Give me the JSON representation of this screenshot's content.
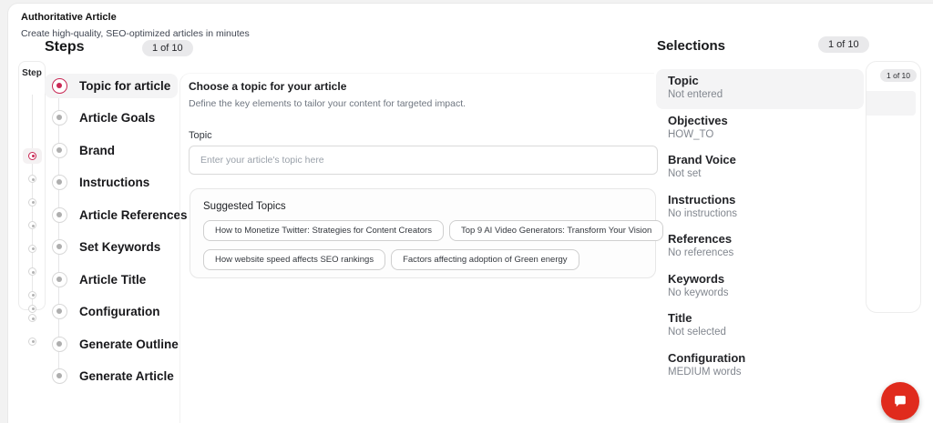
{
  "header": {
    "app_title": "Authoritative Article",
    "app_subtitle": "Create high-quality, SEO-optimized articles in minutes"
  },
  "steps": {
    "title": "Steps",
    "badge": "1 of 10",
    "mini_label": "Step",
    "items": [
      {
        "label": "Topic for article"
      },
      {
        "label": "Article Goals"
      },
      {
        "label": "Brand"
      },
      {
        "label": "Instructions"
      },
      {
        "label": "Article References"
      },
      {
        "label": "Set Keywords"
      },
      {
        "label": "Article Title"
      },
      {
        "label": "Configuration"
      },
      {
        "label": "Generate Outline"
      },
      {
        "label": "Generate Article"
      }
    ],
    "active_index": 0
  },
  "main": {
    "heading": "Choose a topic for your article",
    "description": "Define the key elements to tailor your content for targeted impact.",
    "topic_label": "Topic",
    "topic_placeholder": "Enter your article's topic here",
    "suggested": {
      "title": "Suggested Topics",
      "chips": [
        "How to Monetize Twitter: Strategies for Content Creators",
        "Top 9 AI Video Generators: Transform Your Vision",
        "How website speed affects SEO rankings",
        "Factors affecting adoption of Green energy"
      ]
    }
  },
  "selections": {
    "title": "Selections",
    "badge": "1 of 10",
    "items": [
      {
        "title": "Topic",
        "value": "Not entered"
      },
      {
        "title": "Objectives",
        "value": "HOW_TO"
      },
      {
        "title": "Brand Voice",
        "value": "Not set"
      },
      {
        "title": "Instructions",
        "value": "No instructions"
      },
      {
        "title": "References",
        "value": "No references"
      },
      {
        "title": "Keywords",
        "value": "No keywords"
      },
      {
        "title": "Title",
        "value": "Not selected"
      },
      {
        "title": "Configuration",
        "value": "MEDIUM words"
      }
    ]
  },
  "side_panel": {
    "badge": "1 of 10"
  },
  "icons": {
    "chat": "speech-bubble-icon"
  },
  "colors": {
    "accent": "#c92955",
    "fab_red": "#e02b1d",
    "highlight": "#f4f4f5"
  }
}
